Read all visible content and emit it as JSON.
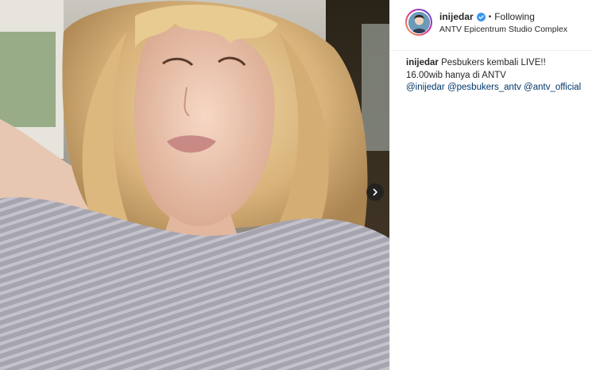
{
  "post": {
    "image_alt": "Selfie of woman with blonde wavy hair wearing a grey ribbed sweater inside a car",
    "carousel_next_icon": "chevron-right-icon"
  },
  "header": {
    "username": "inijedar",
    "verified_icon": "verified-badge-icon",
    "separator": "•",
    "follow_status": "Following",
    "location": "ANTV Epicentrum Studio Complex"
  },
  "caption": {
    "username": "inijedar",
    "text": "Pesbukers kembali LIVE!! 16.00wib hanya di ANTV",
    "mentions": [
      "@inijedar",
      "@pesbukers_antv",
      "@antv_official"
    ]
  },
  "colors": {
    "verified_blue": "#3897f0",
    "mention_link": "#00376b",
    "text": "#262626",
    "border": "#efefef"
  }
}
